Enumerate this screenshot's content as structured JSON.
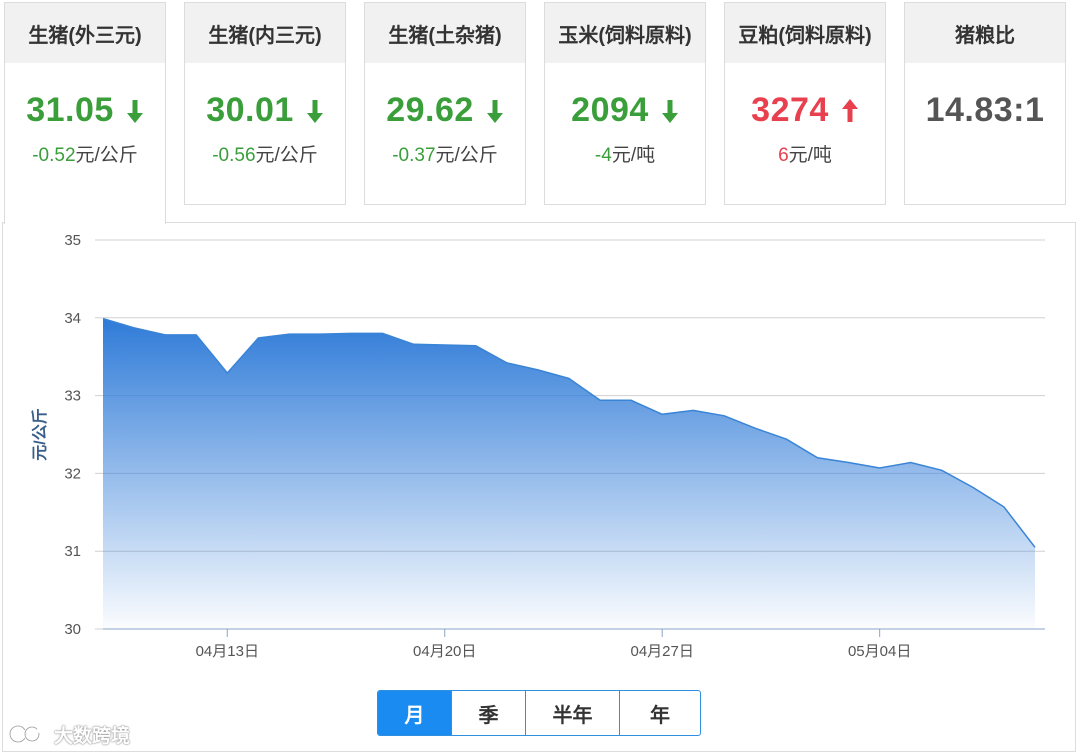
{
  "cards": [
    {
      "title": "生猪(外三元)",
      "value": "31.05",
      "change": "-0.52",
      "unit": "元/公斤",
      "trend": "down"
    },
    {
      "title": "生猪(内三元)",
      "value": "30.01",
      "change": "-0.56",
      "unit": "元/公斤",
      "trend": "down"
    },
    {
      "title": "生猪(土杂猪)",
      "value": "29.62",
      "change": "-0.37",
      "unit": "元/公斤",
      "trend": "down"
    },
    {
      "title": "玉米(饲料原料)",
      "value": "2094",
      "change": "-4",
      "unit": "元/吨",
      "trend": "down"
    },
    {
      "title": "豆粕(饲料原料)",
      "value": "3274",
      "change": "6",
      "unit": "元/吨",
      "trend": "up"
    },
    {
      "title": "猪粮比",
      "value": "14.83:1",
      "change": "",
      "unit": "",
      "trend": "none"
    }
  ],
  "colors": {
    "up": "#e8404f",
    "down": "#3a9e3a",
    "line": "#3a84d6",
    "accent": "#1a8bf0"
  },
  "range_buttons": [
    "月",
    "季",
    "半年",
    "年"
  ],
  "range_selected": "月",
  "watermark": "大数跨境",
  "chart_data": {
    "type": "area",
    "ylabel": "元/公斤",
    "ylim": [
      30,
      35
    ],
    "yticks": [
      30,
      31,
      32,
      33,
      34,
      35
    ],
    "grid": true,
    "xlim": [
      "2023-04-09",
      "2023-05-09"
    ],
    "xticks": [
      {
        "date": "2023-04-13",
        "label": "04月13日"
      },
      {
        "date": "2023-04-20",
        "label": "04月20日"
      },
      {
        "date": "2023-04-27",
        "label": "04月27日"
      },
      {
        "date": "2023-05-04",
        "label": "05月04日"
      }
    ],
    "series": [
      {
        "points": [
          [
            "2023-04-09",
            33.99
          ],
          [
            "2023-04-10",
            33.87
          ],
          [
            "2023-04-11",
            33.78
          ],
          [
            "2023-04-12",
            33.78
          ],
          [
            "2023-04-13",
            33.29
          ],
          [
            "2023-04-14",
            33.74
          ],
          [
            "2023-04-15",
            33.79
          ],
          [
            "2023-04-16",
            33.79
          ],
          [
            "2023-04-17",
            33.8
          ],
          [
            "2023-04-18",
            33.8
          ],
          [
            "2023-04-19",
            33.66
          ],
          [
            "2023-04-20",
            33.65
          ],
          [
            "2023-04-21",
            33.64
          ],
          [
            "2023-04-22",
            33.42
          ],
          [
            "2023-04-23",
            33.33
          ],
          [
            "2023-04-24",
            33.22
          ],
          [
            "2023-04-25",
            32.94
          ],
          [
            "2023-04-26",
            32.94
          ],
          [
            "2023-04-27",
            32.76
          ],
          [
            "2023-04-28",
            32.81
          ],
          [
            "2023-04-29",
            32.74
          ],
          [
            "2023-04-30",
            32.58
          ],
          [
            "2023-05-01",
            32.44
          ],
          [
            "2023-05-02",
            32.2
          ],
          [
            "2023-05-03",
            32.14
          ],
          [
            "2023-05-04",
            32.07
          ],
          [
            "2023-05-05",
            32.14
          ],
          [
            "2023-05-06",
            32.04
          ],
          [
            "2023-05-07",
            31.82
          ],
          [
            "2023-05-08",
            31.57
          ],
          [
            "2023-05-09",
            31.05
          ]
        ]
      }
    ]
  }
}
